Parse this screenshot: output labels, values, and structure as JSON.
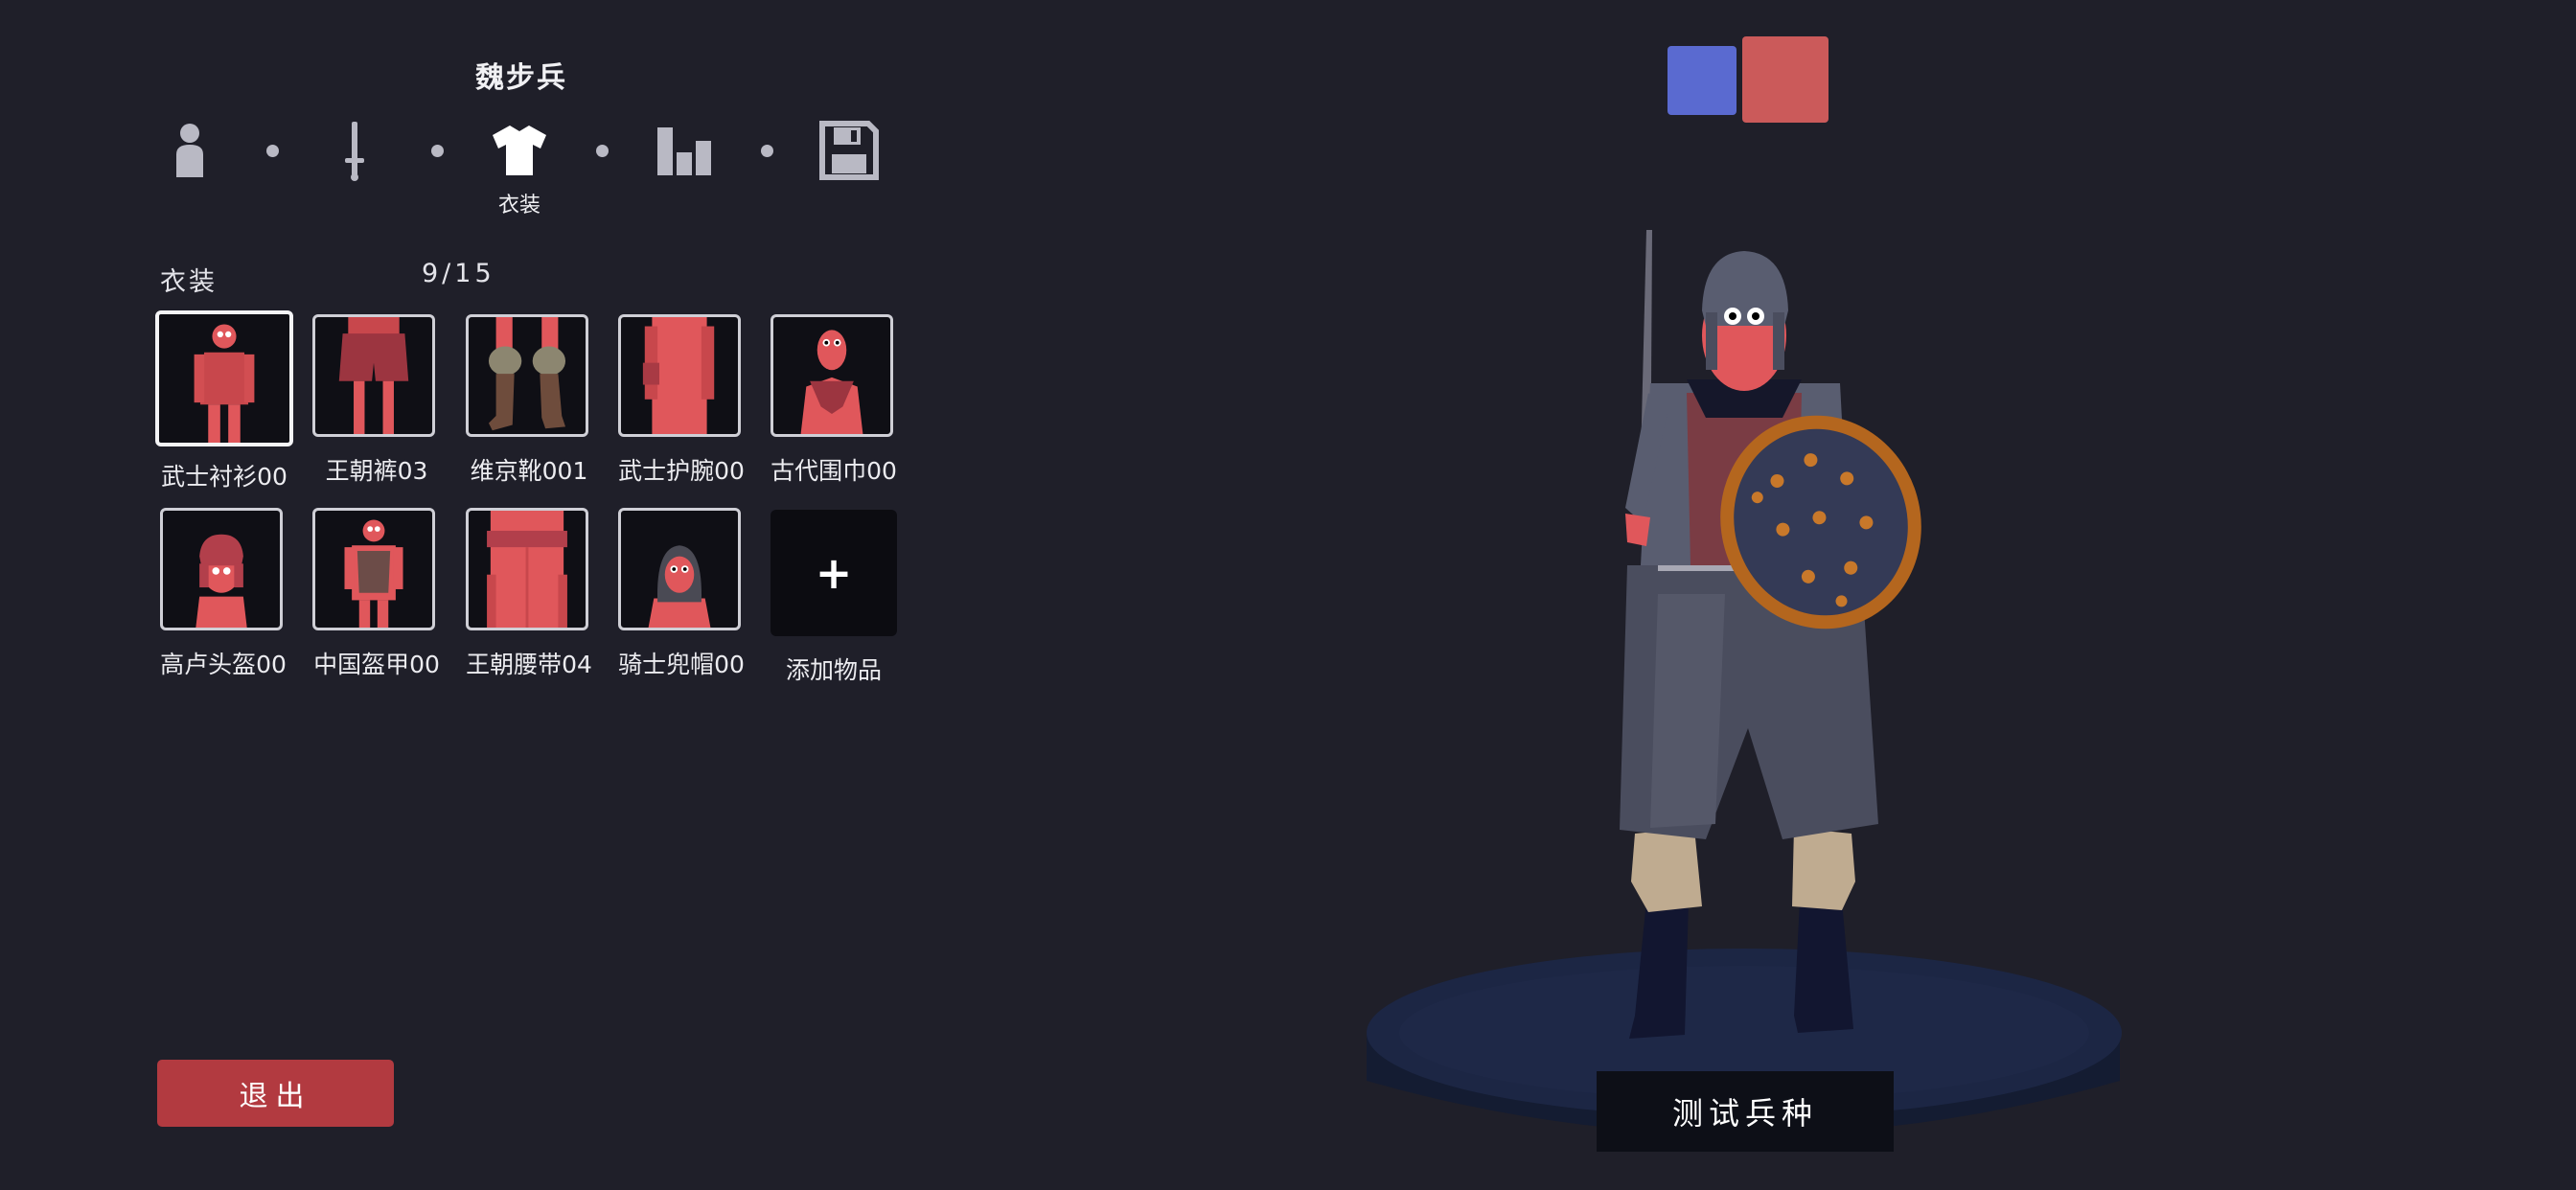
{
  "header": {
    "unit_name": "魏步兵"
  },
  "steps": [
    {
      "icon": "unit-base-icon",
      "label": ""
    },
    {
      "icon": "weapon-icon",
      "label": ""
    },
    {
      "icon": "clothing-icon",
      "label": "衣装",
      "active": true
    },
    {
      "icon": "stats-icon",
      "label": ""
    },
    {
      "icon": "save-icon",
      "label": ""
    }
  ],
  "section": {
    "label": "衣装",
    "count": "9/15"
  },
  "items": [
    {
      "name": "武士衬衫00",
      "icon": "samurai-shirt-icon",
      "selected": true
    },
    {
      "name": "王朝裤03",
      "icon": "dynasty-pants-icon"
    },
    {
      "name": "维京靴001",
      "icon": "viking-boots-icon"
    },
    {
      "name": "武士护腕00",
      "icon": "samurai-bracer-icon"
    },
    {
      "name": "古代围巾00",
      "icon": "ancient-scarf-icon"
    },
    {
      "name": "高卢头盔00",
      "icon": "gallic-helmet-icon"
    },
    {
      "name": "中国盔甲00",
      "icon": "chinese-armor-icon"
    },
    {
      "name": "王朝腰带04",
      "icon": "dynasty-belt-icon"
    },
    {
      "name": "骑士兜帽00",
      "icon": "knight-hood-icon"
    }
  ],
  "add_item": {
    "label": "添加物品",
    "symbol": "+"
  },
  "buttons": {
    "exit": "退出",
    "test": "测试兵种"
  },
  "teams": {
    "blue": "#5a6ad0",
    "red": "#cb5a5a"
  },
  "colors": {
    "background": "#1f1f29",
    "exit_button": "#b23a40",
    "unit_skin": "#e0575b"
  }
}
